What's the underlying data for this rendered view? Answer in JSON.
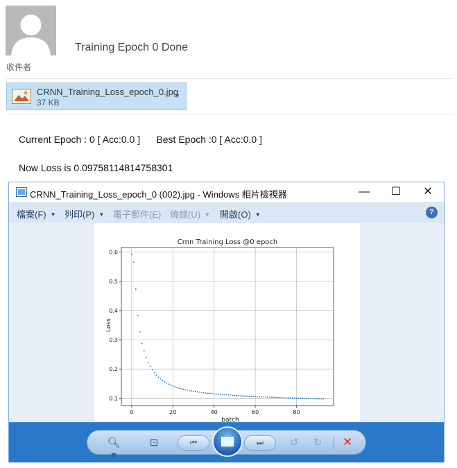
{
  "email": {
    "subject": "Training Epoch 0 Done",
    "recipient_label": "收件者",
    "attachment": {
      "name": "CRNN_Training_Loss_epoch_0.jpg",
      "size": "37 KB"
    },
    "body_line_1": "Current Epoch : 0 [ Acc:0.0 ]      Best Epoch :0 [ Acc:0.0 ]",
    "body_line_2": "Now Loss is 0.09758114814758301"
  },
  "viewer": {
    "title": "CRNN_Training_Loss_epoch_0 (002).jpg - Windows 相片檢視器",
    "window_buttons": {
      "minimize": "—",
      "maximize": "☐",
      "close": "✕"
    },
    "menu": [
      {
        "label": "檔案(F)",
        "enabled": true
      },
      {
        "label": "列印(P)",
        "enabled": true
      },
      {
        "label": "電子郵件(E)",
        "enabled": false
      },
      {
        "label": "燒錄(U)",
        "enabled": false
      },
      {
        "label": "開啟(O)",
        "enabled": true
      }
    ],
    "help": "?",
    "controls": {
      "zoom_icon": "zoom-icon",
      "fit_icon": "actual-size-icon",
      "prev_icon": "previous-icon",
      "slideshow_icon": "slideshow-icon",
      "next_icon": "next-icon",
      "rotate_ccw_icon": "rotate-counterclockwise-icon",
      "rotate_cw_icon": "rotate-clockwise-icon",
      "delete_icon": "delete-icon"
    },
    "colors": {
      "toolbar_blue": "#2a78c8",
      "menu_bg": "#dbe7f5",
      "delete_red": "#d32f2f"
    }
  },
  "chart_data": {
    "type": "scatter",
    "title": "Crnn Training Loss @0 epoch",
    "xlabel": "batch",
    "ylabel": "Loss",
    "xlim": [
      -5,
      98
    ],
    "ylim": [
      0.075,
      0.615
    ],
    "xticks": [
      0,
      20,
      40,
      60,
      80
    ],
    "yticks": [
      0.1,
      0.2,
      0.3,
      0.4,
      0.5,
      0.6
    ],
    "grid": true,
    "marker_color": "#1f77b4",
    "series": [
      {
        "x": [
          0,
          1,
          2,
          3,
          4,
          5,
          6,
          7,
          8,
          9,
          10,
          11,
          12,
          13,
          14,
          15,
          16,
          17,
          18,
          19,
          20,
          21,
          22,
          23,
          24,
          25,
          26,
          27,
          28,
          29,
          30,
          31,
          32,
          33,
          34,
          35,
          36,
          37,
          38,
          39,
          40,
          41,
          42,
          43,
          44,
          45,
          46,
          47,
          48,
          49,
          50,
          51,
          52,
          53,
          54,
          55,
          56,
          57,
          58,
          59,
          60,
          61,
          62,
          63,
          64,
          65,
          66,
          67,
          68,
          69,
          70,
          71,
          72,
          73,
          74,
          75,
          76,
          77,
          78,
          79,
          80,
          81,
          82,
          83,
          84,
          85,
          86,
          87,
          88,
          89,
          90,
          91,
          92,
          93
        ],
        "y": [
          0.592,
          0.565,
          0.473,
          0.382,
          0.327,
          0.288,
          0.262,
          0.24,
          0.223,
          0.209,
          0.197,
          0.188,
          0.179,
          0.172,
          0.166,
          0.161,
          0.156,
          0.152,
          0.148,
          0.145,
          0.142,
          0.139,
          0.137,
          0.135,
          0.133,
          0.131,
          0.129,
          0.128,
          0.126,
          0.125,
          0.124,
          0.123,
          0.122,
          0.121,
          0.12,
          0.119,
          0.118,
          0.117,
          0.117,
          0.116,
          0.115,
          0.115,
          0.114,
          0.113,
          0.113,
          0.112,
          0.112,
          0.111,
          0.111,
          0.11,
          0.11,
          0.109,
          0.109,
          0.108,
          0.108,
          0.108,
          0.107,
          0.107,
          0.106,
          0.106,
          0.106,
          0.105,
          0.105,
          0.105,
          0.104,
          0.104,
          0.104,
          0.104,
          0.103,
          0.103,
          0.103,
          0.102,
          0.102,
          0.102,
          0.102,
          0.101,
          0.101,
          0.101,
          0.101,
          0.1,
          0.1,
          0.1,
          0.1,
          0.1,
          0.099,
          0.099,
          0.099,
          0.099,
          0.099,
          0.098,
          0.098,
          0.098,
          0.098,
          0.098
        ]
      }
    ]
  }
}
